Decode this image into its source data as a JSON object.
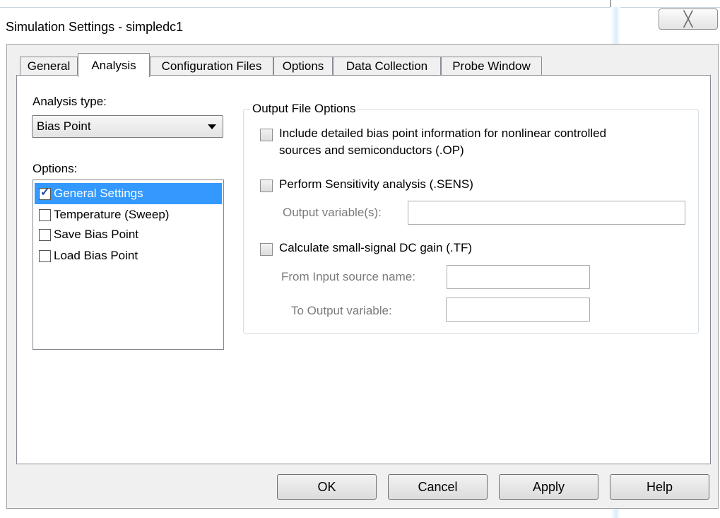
{
  "window": {
    "title": "Simulation Settings - simpledc1",
    "close_glyph": "╳"
  },
  "tabs": [
    {
      "label": "General"
    },
    {
      "label": "Analysis"
    },
    {
      "label": "Configuration Files"
    },
    {
      "label": "Options"
    },
    {
      "label": "Data Collection"
    },
    {
      "label": "Probe Window"
    }
  ],
  "active_tab": "Analysis",
  "analysis": {
    "type_label": "Analysis type:",
    "type_value": "Bias Point",
    "options_label": "Options:",
    "options": [
      {
        "label": "General Settings",
        "checked": true,
        "selected": true
      },
      {
        "label": "Temperature (Sweep)",
        "checked": false,
        "selected": false
      },
      {
        "label": "Save Bias Point",
        "checked": false,
        "selected": false
      },
      {
        "label": "Load Bias Point",
        "checked": false,
        "selected": false
      }
    ]
  },
  "output_file_options": {
    "title": "Output File Options",
    "op_line1": "Include detailed bias point information for nonlinear controlled",
    "op_line2": "sources and semiconductors (.OP)",
    "sens_label": "Perform Sensitivity analysis (.SENS)",
    "output_variables_label": "Output variable(s):",
    "output_variables_value": "",
    "tf_label": "Calculate small-signal DC gain (.TF)",
    "from_input_label": "From Input source name:",
    "from_input_value": "",
    "to_output_label": "To Output variable:",
    "to_output_value": ""
  },
  "buttons": {
    "ok": "OK",
    "cancel": "Cancel",
    "apply": "Apply",
    "help": "Help"
  }
}
